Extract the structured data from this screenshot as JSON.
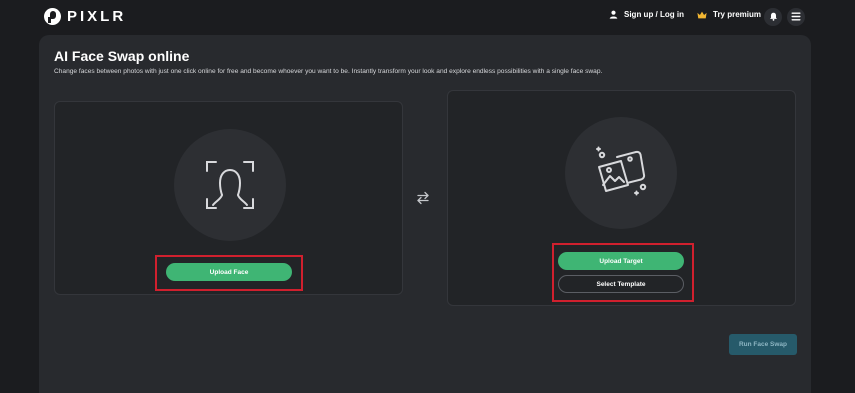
{
  "header": {
    "brand": "PIXLR",
    "signup_label": "Sign up / Log in",
    "premium_label": "Try premium"
  },
  "main": {
    "title": "AI Face Swap online",
    "subtitle": "Change faces between photos with just one click online for free and become whoever you want to be. Instantly transform your look and explore endless possibilities with a single face swap."
  },
  "face_panel": {
    "upload_label": "Upload Face"
  },
  "target_panel": {
    "upload_label": "Upload Target",
    "template_label": "Select Template"
  },
  "run_label": "Run Face Swap",
  "colors": {
    "background": "#1b1c1f",
    "card": "#282a2e",
    "accent_green": "#3fb574",
    "highlight_red": "#d0202e",
    "run_button": "#265a6a"
  },
  "icons": [
    "logo-icon",
    "user-icon",
    "crown-icon",
    "bell-icon",
    "menu-icon",
    "face-scan-icon",
    "swap-arrows-icon",
    "images-icon"
  ]
}
